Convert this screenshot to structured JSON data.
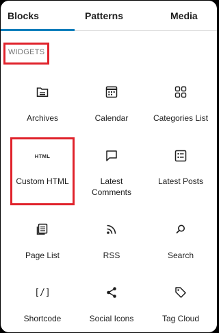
{
  "tabs": [
    {
      "label": "Blocks",
      "active": true
    },
    {
      "label": "Patterns",
      "active": false
    },
    {
      "label": "Media",
      "active": false
    }
  ],
  "section": {
    "title": "WIDGETS"
  },
  "blocks": [
    {
      "label": "Archives",
      "icon": "archive-folder-icon"
    },
    {
      "label": "Calendar",
      "icon": "calendar-icon"
    },
    {
      "label": "Categories List",
      "icon": "categories-grid-icon"
    },
    {
      "label": "Custom HTML",
      "icon": "html-icon",
      "icon_text": "HTML"
    },
    {
      "label": "Latest\nComments",
      "icon": "comment-bubble-icon"
    },
    {
      "label": "Latest Posts",
      "icon": "post-list-icon"
    },
    {
      "label": "Page List",
      "icon": "page-list-icon"
    },
    {
      "label": "RSS",
      "icon": "rss-icon"
    },
    {
      "label": "Search",
      "icon": "search-icon"
    },
    {
      "label": "Shortcode",
      "icon": "shortcode-icon",
      "icon_text": "[/]"
    },
    {
      "label": "Social Icons",
      "icon": "share-icon"
    },
    {
      "label": "Tag Cloud",
      "icon": "tag-icon"
    }
  ],
  "colors": {
    "accent": "#007cba",
    "highlight": "#e0222b",
    "text": "#1e1e1e",
    "muted": "#757575"
  }
}
